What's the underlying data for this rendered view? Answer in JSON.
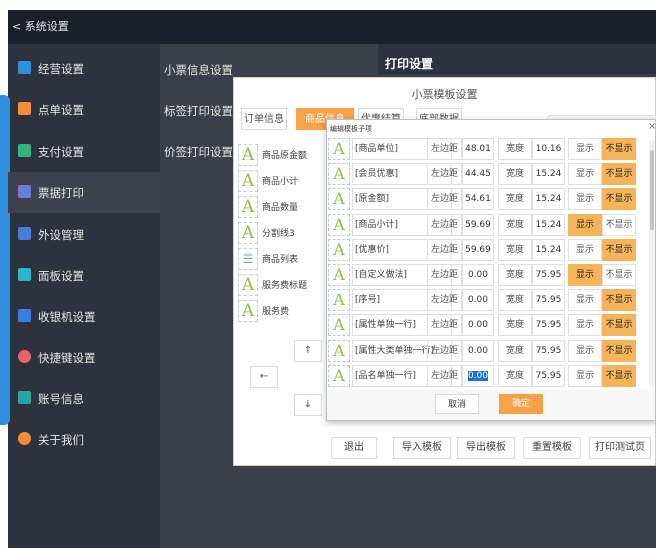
{
  "app": {
    "back_label": "< 系统设置"
  },
  "sidebar": {
    "items": [
      {
        "label": "经营设置",
        "color": "#2f8fe0"
      },
      {
        "label": "点单设置",
        "color": "#f28c38"
      },
      {
        "label": "支付设置",
        "color": "#36b37e"
      },
      {
        "label": "票据打印",
        "color": "#6b7bd6"
      },
      {
        "label": "外设管理",
        "color": "#4a7bd6"
      },
      {
        "label": "面板设置",
        "color": "#2fb5c9"
      },
      {
        "label": "收银机设置",
        "color": "#3d7de0"
      },
      {
        "label": "快捷键设置",
        "color": "#e8606a"
      },
      {
        "label": "账号信息",
        "color": "#27a7a0"
      },
      {
        "label": "关于我们",
        "color": "#f28c38"
      }
    ]
  },
  "column2": {
    "items": [
      "小票信息设置",
      "标签打印设置",
      "价签打印设置"
    ]
  },
  "print_settings": {
    "title": "打印设置"
  },
  "template_dialog": {
    "title": "小票模板设置",
    "tabs": [
      "订单信息",
      "商品信息",
      "优惠结算",
      "底部数据"
    ],
    "left_items": [
      "商品原金额",
      "商品小计",
      "商品数量",
      "分割线3",
      "商品列表",
      "服务费标题",
      "服务费"
    ],
    "arrows": {
      "up": "↑",
      "left": "←",
      "down": "↓"
    },
    "footer_buttons": [
      "退出",
      "导入模板",
      "导出模板",
      "重置模板",
      "打印测试页"
    ]
  },
  "edit_dialog": {
    "title": "编辑模板子项",
    "close": "×",
    "rows": [
      {
        "name": "[商品单位]",
        "margin_label": "左边距",
        "margin": "48.01",
        "width_label": "宽度",
        "width": "10.16",
        "show": "显示",
        "hide": "不显示",
        "state": "hide"
      },
      {
        "name": "[会员优惠]",
        "margin_label": "左边距",
        "margin": "44.45",
        "width_label": "宽度",
        "width": "15.24",
        "show": "显示",
        "hide": "不显示",
        "state": "hide"
      },
      {
        "name": "[原金额]",
        "margin_label": "左边距",
        "margin": "54.61",
        "width_label": "宽度",
        "width": "15.24",
        "show": "显示",
        "hide": "不显示",
        "state": "hide"
      },
      {
        "name": "[商品小计]",
        "margin_label": "左边距",
        "margin": "59.69",
        "width_label": "宽度",
        "width": "15.24",
        "show": "显示",
        "hide": "不显示",
        "state": "show"
      },
      {
        "name": "[优惠价]",
        "margin_label": "左边距",
        "margin": "59.69",
        "width_label": "宽度",
        "width": "15.24",
        "show": "显示",
        "hide": "不显示",
        "state": "hide"
      },
      {
        "name": "[自定义做法]",
        "margin_label": "左边距",
        "margin": "0.00",
        "width_label": "宽度",
        "width": "75.95",
        "show": "显示",
        "hide": "不显示",
        "state": "show"
      },
      {
        "name": "[序号]",
        "margin_label": "左边距",
        "margin": "0.00",
        "width_label": "宽度",
        "width": "75.95",
        "show": "显示",
        "hide": "不显示",
        "state": "hide"
      },
      {
        "name": "[属性单独一行]",
        "margin_label": "左边距",
        "margin": "0.00",
        "width_label": "宽度",
        "width": "75.95",
        "show": "显示",
        "hide": "不显示",
        "state": "hide"
      },
      {
        "name": "[属性大类单独一行]",
        "margin_label": "左边距",
        "margin": "0.00",
        "width_label": "宽度",
        "width": "75.95",
        "show": "显示",
        "hide": "不显示",
        "state": "hide"
      },
      {
        "name": "[品名单独一行]",
        "margin_label": "左边距",
        "margin": "0.00",
        "width_label": "宽度",
        "width": "75.95",
        "show": "显示",
        "hide": "不显示",
        "state": "hide"
      }
    ],
    "cancel": "取消",
    "confirm": "确定"
  },
  "colors": {
    "accent": "#f5a24a",
    "sidebar_bg": "#2d323d",
    "titlebar_bg": "#1b1f2a"
  }
}
